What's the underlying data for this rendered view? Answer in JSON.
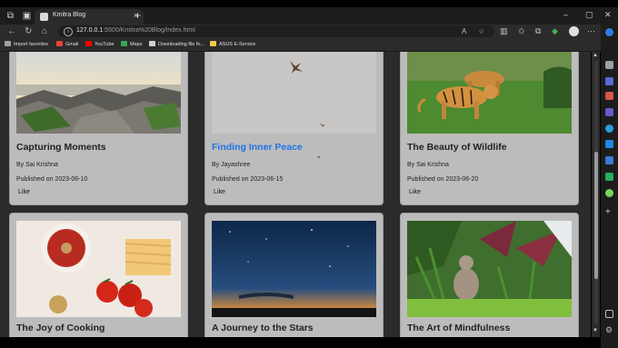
{
  "browser": {
    "tab_title": "Kmitra Blog",
    "tab_close": "×",
    "new_tab": "+",
    "url_host": "127.0.0.1",
    "url_rest": ":5500/Kmitra%20Blog/index.html",
    "window_min": "–",
    "window_max": "▢",
    "window_close": "✕"
  },
  "bookmarks": [
    {
      "label": "Import favorites",
      "color": "#9e9e9e"
    },
    {
      "label": "Gmail",
      "color": "#ea4335"
    },
    {
      "label": "YouTube",
      "color": "#ff0000"
    },
    {
      "label": "Maps",
      "color": "#34a853"
    },
    {
      "label": "Downloading file fo...",
      "color": "#d0d0d0"
    },
    {
      "label": "ASUS E-Service",
      "color": "#f2c94c"
    }
  ],
  "posts": [
    {
      "title": "Capturing Moments",
      "author": "By Sai Krishna",
      "published": "Published on 2023-06-10",
      "like": "Like"
    },
    {
      "title": "Finding Inner Peace",
      "author": "By Jayashree",
      "published": "Published on 2023-06-15",
      "like": "Like"
    },
    {
      "title": "The Beauty of Wildlife",
      "author": "By Sai Krishna",
      "published": "Published on 2023-06-20",
      "like": "Like"
    },
    {
      "title": "The Joy of Cooking"
    },
    {
      "title": "A Journey to the Stars"
    },
    {
      "title": "The Art of Mindfulness"
    }
  ],
  "colors": {
    "card_bg": "#bcbcbc",
    "page_bg": "#2b2b2b",
    "link_title": "#1e73e8"
  }
}
